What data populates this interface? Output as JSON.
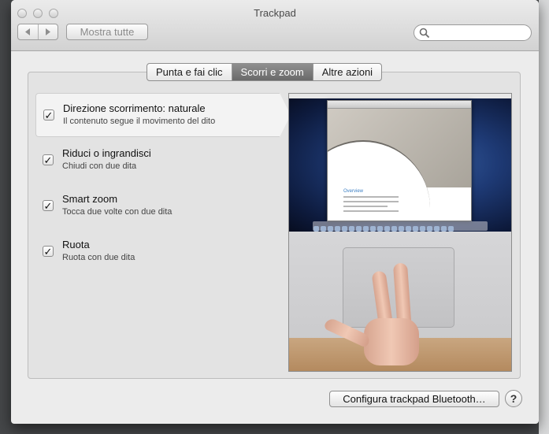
{
  "window": {
    "title": "Trackpad"
  },
  "toolbar": {
    "back_icon": "chevron-left-icon",
    "forward_icon": "chevron-right-icon",
    "show_all_label": "Mostra tutte",
    "search_placeholder": "",
    "search_icon": "search-icon"
  },
  "tabs": [
    {
      "label": "Punta e fai clic",
      "selected": false
    },
    {
      "label": "Scorri e zoom",
      "selected": true
    },
    {
      "label": "Altre azioni",
      "selected": false
    }
  ],
  "options": [
    {
      "title": "Direzione scorrimento: naturale",
      "subtitle": "Il contenuto segue il movimento del dito",
      "checked": true,
      "selected": true
    },
    {
      "title": "Riduci o ingrandisci",
      "subtitle": "Chiudi con due dita",
      "checked": true,
      "selected": false
    },
    {
      "title": "Smart zoom",
      "subtitle": "Tocca due volte con due dita",
      "checked": true,
      "selected": false
    },
    {
      "title": "Ruota",
      "subtitle": "Ruota con due dita",
      "checked": true,
      "selected": false
    }
  ],
  "preview": {
    "doc_heading": "Overview"
  },
  "footer": {
    "bluetooth_label": "Configura trackpad Bluetooth…",
    "help_label": "?"
  },
  "colors": {
    "selected_tab": "#7a7a7a",
    "window_bg": "#ececec",
    "panel_bg": "#e3e3e3"
  }
}
